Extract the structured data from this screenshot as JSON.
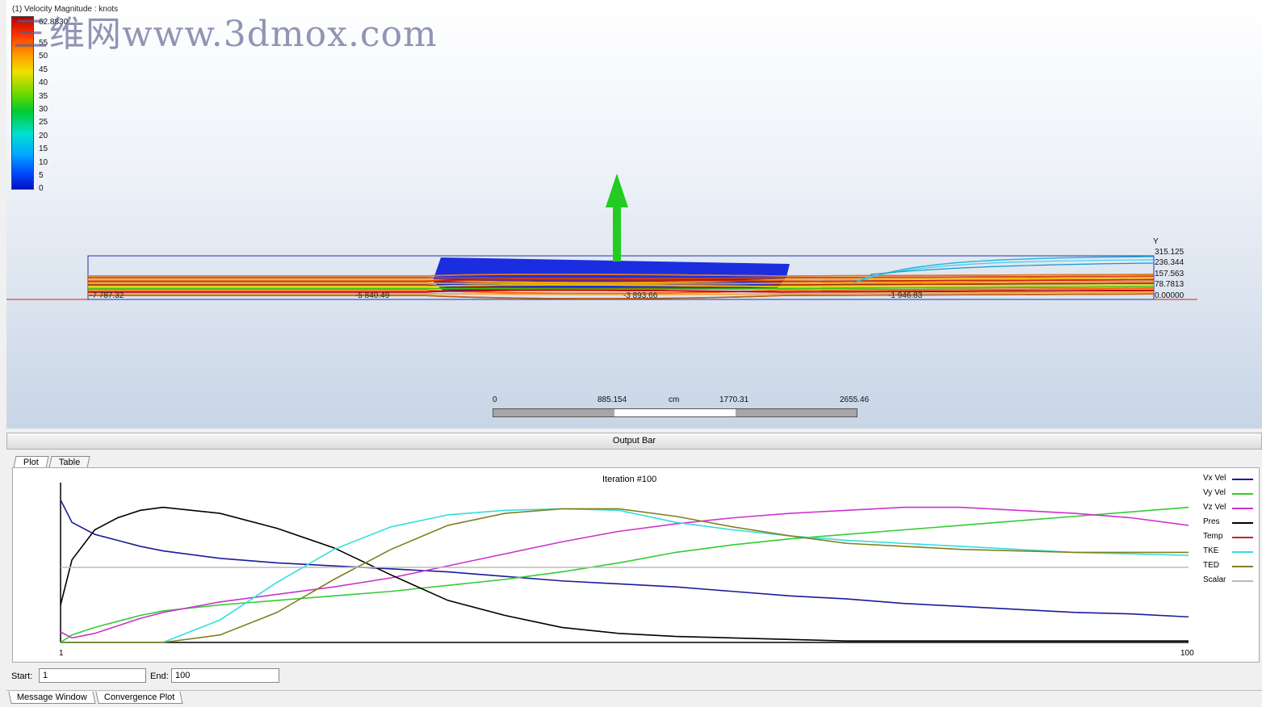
{
  "viewport": {
    "legend_title": "(1) Velocity Magnitude : knots",
    "legend_max": "62.8830",
    "legend_labels": [
      "55",
      "50",
      "45",
      "40",
      "35",
      "30",
      "25",
      "20",
      "15",
      "10",
      "5",
      "0"
    ],
    "watermark": "三维网www.3dmox.com",
    "domain_labels": [
      "-7 787.32",
      "-5 840.49",
      "-3 893.66",
      "-1 946.83"
    ],
    "y_axis_title": "Y",
    "y_axis_labels": [
      "315.125",
      "236.344",
      "157.563",
      "78.7813",
      "0.00000"
    ],
    "scale_labels": {
      "zero": "0",
      "first": "885.154",
      "unit": "cm",
      "second": "1770.31",
      "third": "2655.46"
    },
    "colors": {
      "hull": "#1a2ee0",
      "arrow": "#22cc22",
      "domain_box": "#2233aa",
      "axis_line": "#d02020"
    }
  },
  "output_bar": {
    "title": "Output Bar"
  },
  "tabs": [
    {
      "label": "Plot"
    },
    {
      "label": "Table"
    }
  ],
  "plot": {
    "title": "Iteration #100",
    "x_start_label": "1",
    "x_end_label": "100"
  },
  "range": {
    "start_label": "Start:",
    "start_value": "1",
    "end_label": "End:",
    "end_value": "100"
  },
  "bottom_tabs": [
    {
      "label": "Message Window"
    },
    {
      "label": "Convergence Plot"
    }
  ],
  "chart_data": {
    "type": "line",
    "title": "Iteration #100",
    "xlim": [
      1,
      100
    ],
    "ylim": [
      0,
      1
    ],
    "x": [
      1,
      2,
      4,
      6,
      8,
      10,
      15,
      20,
      25,
      30,
      35,
      40,
      45,
      50,
      55,
      60,
      65,
      70,
      75,
      80,
      85,
      90,
      95,
      100
    ],
    "series": [
      {
        "name": "Vx Vel",
        "color": "#1a1a99",
        "values": [
          0.95,
          0.8,
          0.72,
          0.68,
          0.64,
          0.61,
          0.56,
          0.53,
          0.51,
          0.49,
          0.47,
          0.44,
          0.41,
          0.39,
          0.37,
          0.34,
          0.31,
          0.29,
          0.26,
          0.24,
          0.22,
          0.2,
          0.19,
          0.17
        ]
      },
      {
        "name": "Vy Vel",
        "color": "#33cc33",
        "values": [
          0.0,
          0.05,
          0.1,
          0.14,
          0.18,
          0.21,
          0.25,
          0.28,
          0.31,
          0.34,
          0.38,
          0.42,
          0.47,
          0.53,
          0.6,
          0.65,
          0.69,
          0.72,
          0.75,
          0.78,
          0.81,
          0.84,
          0.87,
          0.9
        ]
      },
      {
        "name": "Vz Vel",
        "color": "#cc33cc",
        "values": [
          0.07,
          0.03,
          0.06,
          0.11,
          0.16,
          0.2,
          0.27,
          0.32,
          0.37,
          0.43,
          0.51,
          0.59,
          0.67,
          0.74,
          0.79,
          0.83,
          0.86,
          0.88,
          0.9,
          0.9,
          0.88,
          0.86,
          0.83,
          0.78
        ]
      },
      {
        "name": "Pres",
        "color": "#000000",
        "values": [
          0.25,
          0.55,
          0.75,
          0.83,
          0.88,
          0.9,
          0.86,
          0.76,
          0.63,
          0.45,
          0.28,
          0.18,
          0.1,
          0.06,
          0.04,
          0.03,
          0.02,
          0.01,
          0.01,
          0.01,
          0.01,
          0.01,
          0.01,
          0.01
        ]
      },
      {
        "name": "Temp",
        "color": "#cc2222",
        "values": []
      },
      {
        "name": "TKE",
        "color": "#33dddd",
        "values": [
          0.0,
          0.0,
          0.0,
          0.0,
          0.0,
          0.0,
          0.15,
          0.4,
          0.62,
          0.77,
          0.85,
          0.88,
          0.89,
          0.88,
          0.8,
          0.75,
          0.71,
          0.68,
          0.66,
          0.64,
          0.62,
          0.6,
          0.59,
          0.58
        ]
      },
      {
        "name": "TED",
        "color": "#808020",
        "values": [
          0.0,
          0.0,
          0.0,
          0.0,
          0.0,
          0.0,
          0.05,
          0.2,
          0.42,
          0.62,
          0.78,
          0.86,
          0.89,
          0.89,
          0.84,
          0.77,
          0.71,
          0.66,
          0.64,
          0.62,
          0.61,
          0.6,
          0.6,
          0.6
        ]
      },
      {
        "name": "Scalar",
        "color": "#bbbbbb",
        "values": [
          0.5,
          0.5,
          0.5,
          0.5,
          0.5,
          0.5,
          0.5,
          0.5,
          0.5,
          0.5,
          0.5,
          0.5,
          0.5,
          0.5,
          0.5,
          0.5,
          0.5,
          0.5,
          0.5,
          0.5,
          0.5,
          0.5,
          0.5,
          0.5
        ]
      }
    ]
  }
}
